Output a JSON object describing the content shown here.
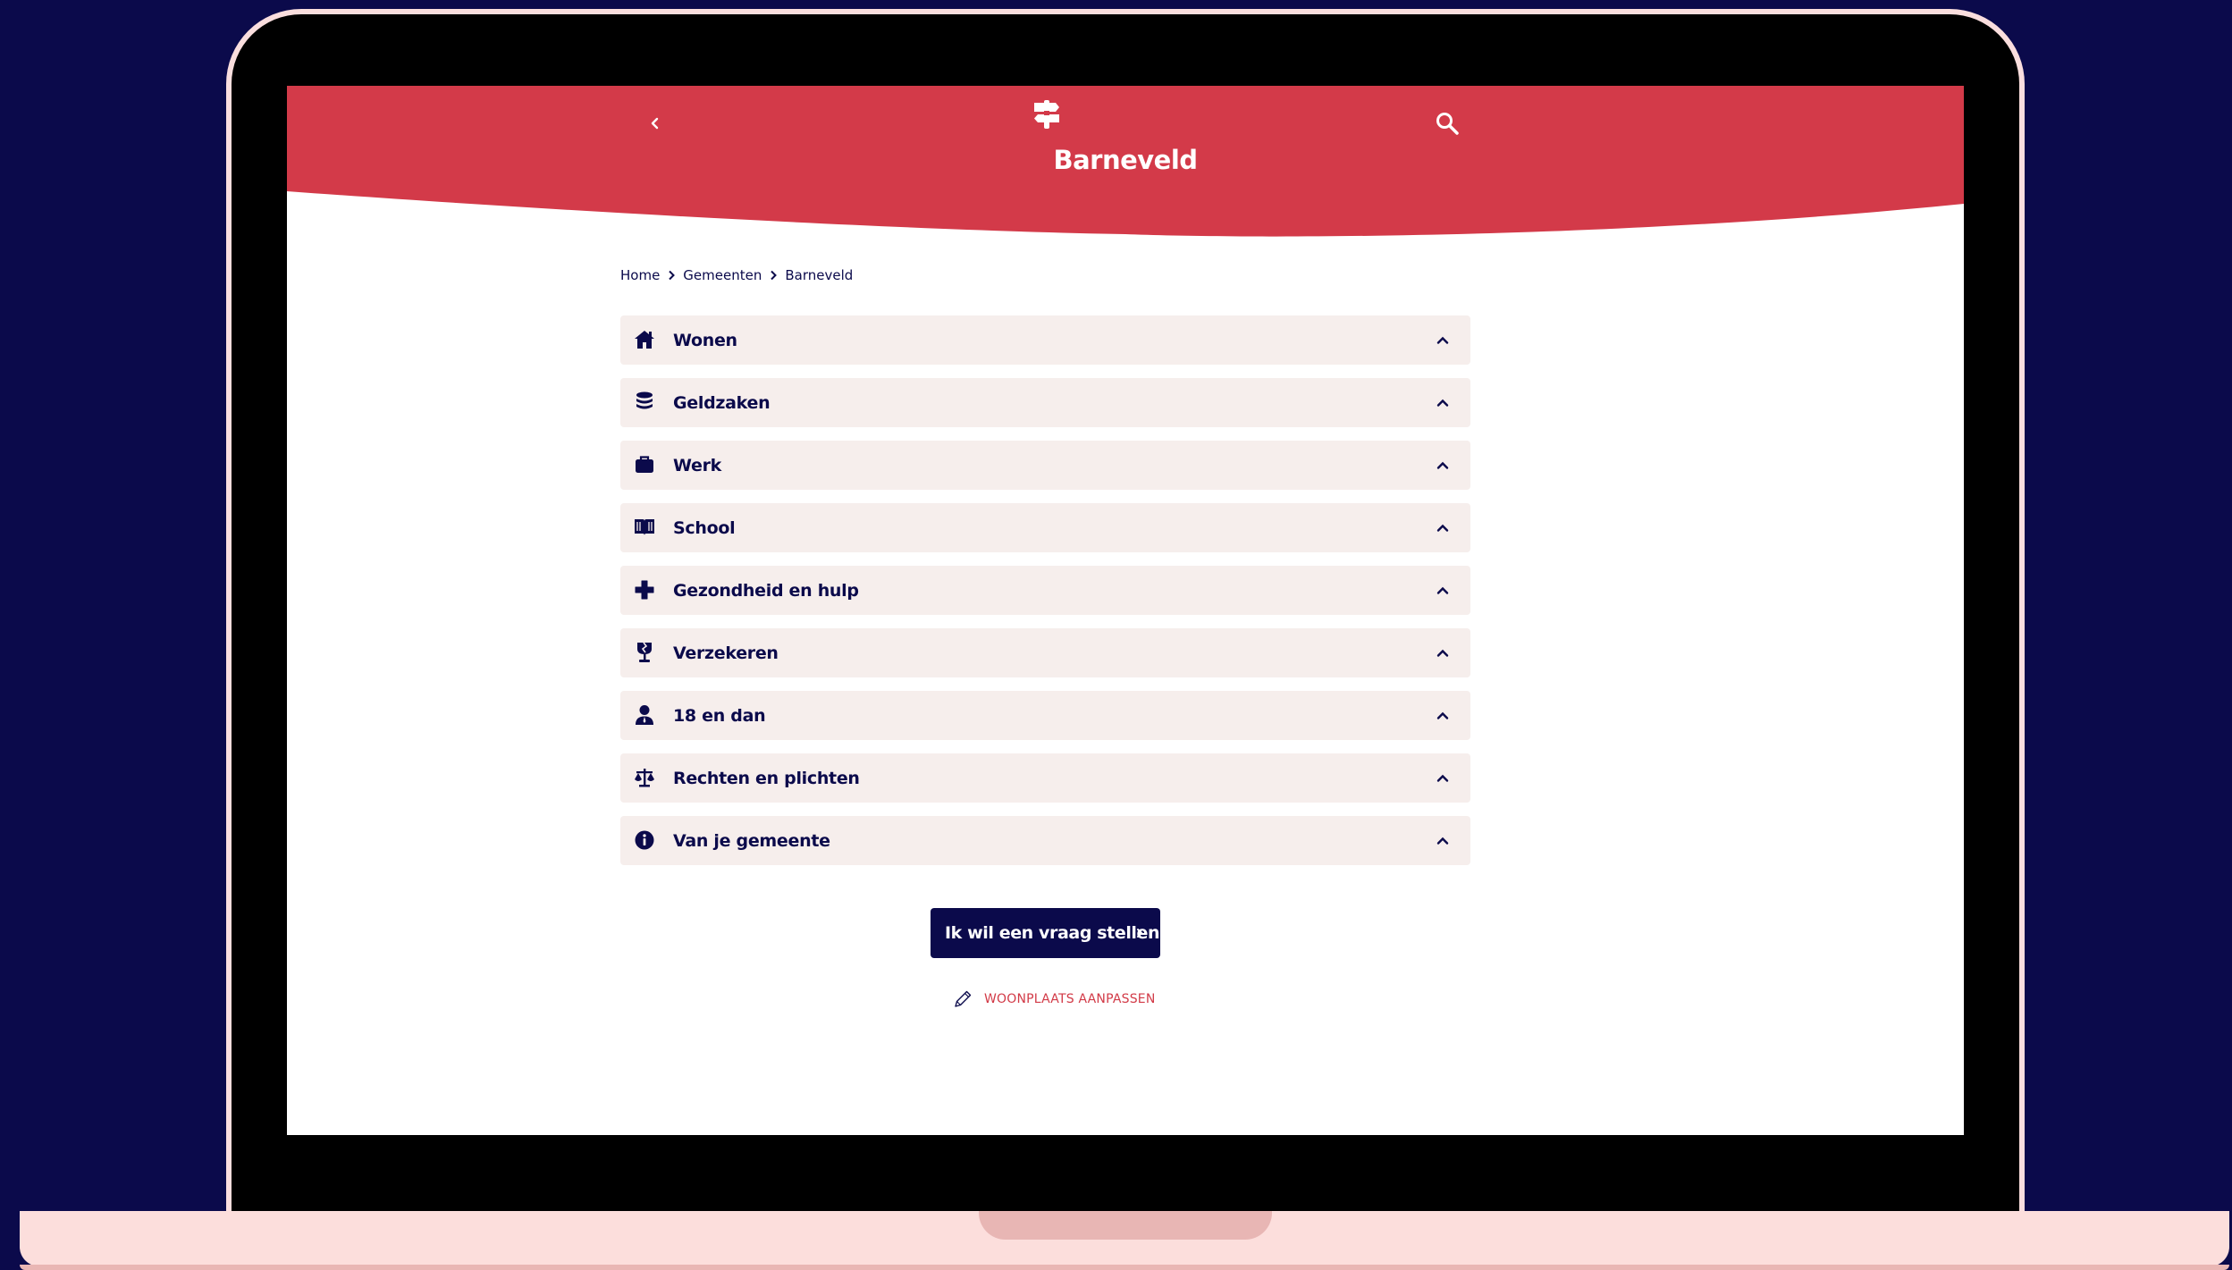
{
  "header": {
    "title": "Barneveld",
    "back_icon": "chevron-left-icon",
    "logo_icon": "signpost-icon",
    "search_icon": "search-icon",
    "brand_color": "#d33a49"
  },
  "breadcrumb": {
    "items": [
      "Home",
      "Gemeenten",
      "Barneveld"
    ]
  },
  "categories": [
    {
      "label": "Wonen",
      "icon": "house-icon"
    },
    {
      "label": "Geldzaken",
      "icon": "coins-icon"
    },
    {
      "label": "Werk",
      "icon": "briefcase-icon"
    },
    {
      "label": "School",
      "icon": "book-icon"
    },
    {
      "label": "Gezondheid en hulp",
      "icon": "medical-cross-icon"
    },
    {
      "label": "Verzekeren",
      "icon": "broken-glass-icon"
    },
    {
      "label": "18 en dan",
      "icon": "person-icon"
    },
    {
      "label": "Rechten en plichten",
      "icon": "scales-icon"
    },
    {
      "label": "Van je gemeente",
      "icon": "info-icon"
    }
  ],
  "actions": {
    "ask_label": "Ik wil een vraag stellen",
    "edit_location_label": "WOONPLAATS AANPASSEN"
  },
  "colors": {
    "navy": "#0b0a4b",
    "accordion_bg": "#f6eeec",
    "frame": "#fcdedc"
  }
}
